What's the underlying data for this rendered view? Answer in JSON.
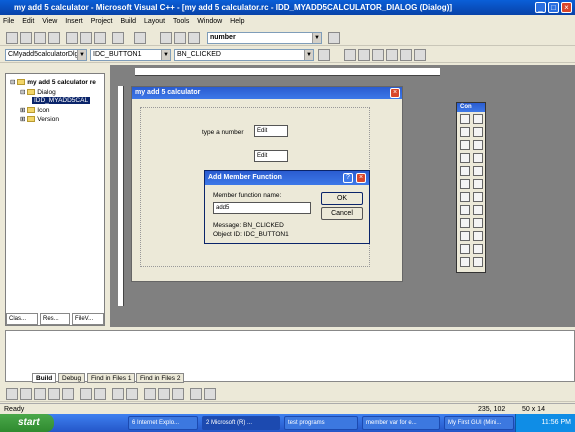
{
  "window": {
    "title": "my add 5 calculator - Microsoft Visual C++ - [my add 5 calculator.rc - IDD_MYADD5CALCULATOR_DIALOG (Dialog)]"
  },
  "menu": [
    "File",
    "Edit",
    "View",
    "Insert",
    "Project",
    "Build",
    "Layout",
    "Tools",
    "Window",
    "Help"
  ],
  "toolbar": {
    "find_combo": "number"
  },
  "wizardbar": {
    "class": "CMyadd5calculatorDlg",
    "id": "IDC_BUTTON1",
    "message": "BN_CLICKED"
  },
  "workspace": {
    "root": "my add 5 calculator re",
    "dialog_folder": "Dialog",
    "dialog_item": "IDD_MYADD5CAL",
    "icon_folder": "Icon",
    "version_folder": "Version",
    "tabs": [
      "Clas...",
      "Res...",
      "FileV..."
    ]
  },
  "design_dialog": {
    "title": "my add 5 calculator",
    "label": "type a number",
    "edit1": "Edit",
    "edit2": "Edit"
  },
  "add_member": {
    "title": "Add Member Function",
    "name_label": "Member function name:",
    "name_value": "add5",
    "ok": "OK",
    "cancel": "Cancel",
    "message": "Message: BN_CLICKED",
    "object": "Object ID: IDC_BUTTON1"
  },
  "controls_panel": {
    "title": "Con"
  },
  "output_tabs": [
    "Build",
    "Debug",
    "Find in Files 1",
    "Find in Files 2"
  ],
  "status": {
    "text": "Ready",
    "coords": "235, 102",
    "size": "50 x 14"
  },
  "taskbar": {
    "start": "start",
    "items": [
      "6 Internet Explo...",
      "2 Microsoft (R) ...",
      "test programs",
      "member var for e...",
      "My First GUI (Mini..."
    ],
    "clock": "11:56 PM"
  }
}
